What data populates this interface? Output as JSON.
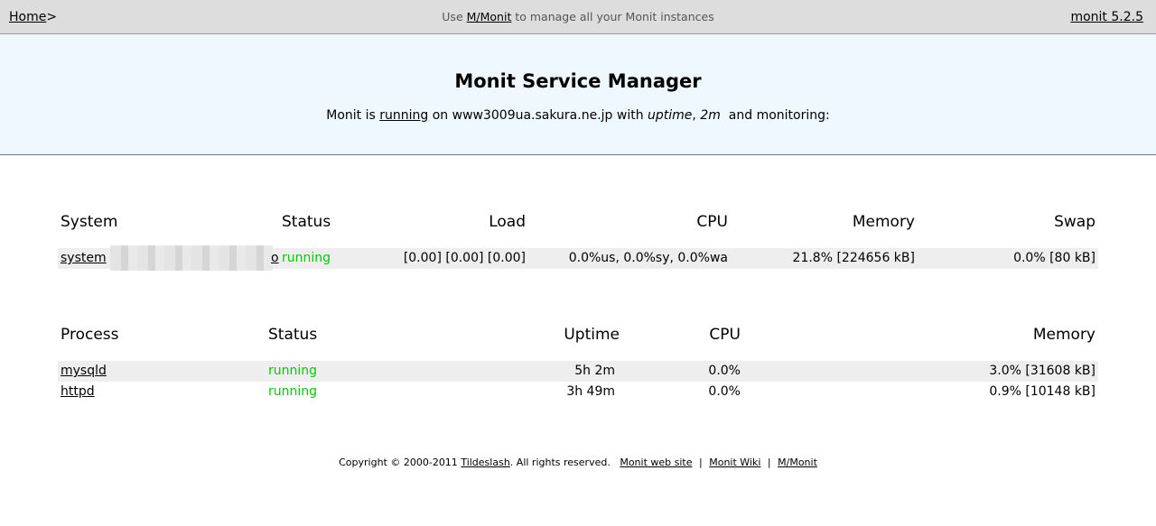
{
  "nav": {
    "home_link": "Home",
    "home_suffix": ">",
    "center_prefix": "Use",
    "center_link": "M/Monit",
    "center_suffix": "to manage all your Monit instances",
    "version_link": "monit 5.2.5"
  },
  "header": {
    "title": "Monit Service Manager",
    "sub_prefix": "Monit is",
    "sub_status_link": "running",
    "sub_mid": "on www3009ua.sakura.ne.jp with",
    "sub_uptime_label": "uptime",
    "sub_uptime_value": "2m",
    "sub_suffix": "and monitoring:"
  },
  "system_table": {
    "headers": {
      "system": "System",
      "status": "Status",
      "load": "Load",
      "cpu": "CPU",
      "memory": "Memory",
      "swap": "Swap"
    },
    "rows": [
      {
        "name": "system",
        "name_tail": "o",
        "status": "running",
        "load": "[0.00] [0.00] [0.00]",
        "cpu": "0.0%us, 0.0%sy, 0.0%wa",
        "memory": "21.8% [224656 kB]",
        "swap": "0.0% [80 kB]"
      }
    ]
  },
  "process_table": {
    "headers": {
      "process": "Process",
      "status": "Status",
      "uptime": "Uptime",
      "cpu": "CPU",
      "memory": "Memory"
    },
    "rows": [
      {
        "name": "mysqld",
        "status": "running",
        "uptime": "5h 2m",
        "cpu": "0.0%",
        "memory": "3.0% [31608 kB]"
      },
      {
        "name": "httpd",
        "status": "running",
        "uptime": "3h 49m",
        "cpu": "0.0%",
        "memory": "0.9% [10148 kB]"
      }
    ]
  },
  "footer": {
    "copyright_prefix": "Copyright © 2000-2011",
    "company_link": "Tildeslash",
    "rights": ". All rights reserved.",
    "link_website": "Monit web site",
    "link_wiki": "Monit Wiki",
    "link_mmonit": "M/Monit",
    "separator": "|"
  },
  "colors": {
    "nav_bg": "#dddddd",
    "header_bg": "#eff7ff",
    "row_shade": "#eeeeee",
    "status_running": "#00cc00"
  }
}
